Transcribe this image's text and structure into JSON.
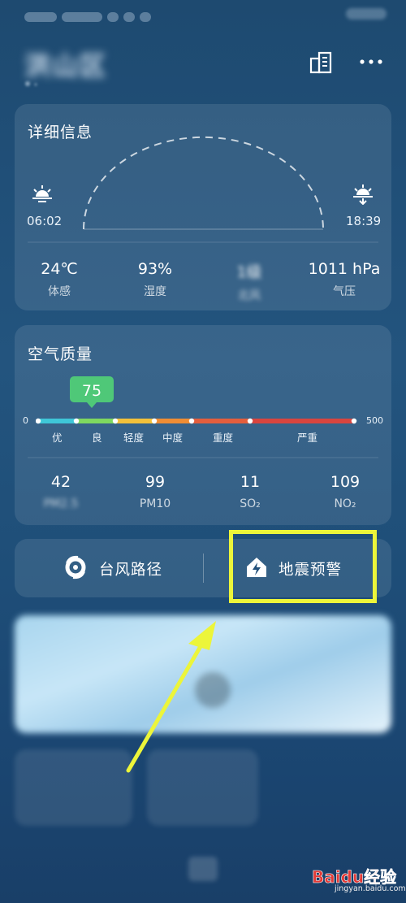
{
  "status_bar": {
    "left": "",
    "right": ""
  },
  "header": {
    "location": "洪山区"
  },
  "details": {
    "title": "详细信息",
    "sunrise": "06:02",
    "sunset": "18:39",
    "stats": [
      {
        "value": "24℃",
        "label": "体感"
      },
      {
        "value": "93%",
        "label": "湿度"
      },
      {
        "value": "1级",
        "label": "北风"
      },
      {
        "value": "1011 hPa",
        "label": "气压"
      }
    ]
  },
  "air_quality": {
    "title": "空气质量",
    "aqi": "75",
    "scale_min": "0",
    "scale_max": "500",
    "levels": [
      "优",
      "良",
      "轻度",
      "中度",
      "重度",
      "严重"
    ],
    "level_colors": [
      "#3fc7d8",
      "#7fd85f",
      "#f3c13a",
      "#f08d34",
      "#e45e3d",
      "#d9453f"
    ],
    "pollutants": [
      {
        "value": "42",
        "label": "PM2.5"
      },
      {
        "value": "99",
        "label": "PM10"
      },
      {
        "value": "11",
        "label": "SO₂"
      },
      {
        "value": "109",
        "label": "NO₂"
      }
    ]
  },
  "features": {
    "typhoon_label": "台风路径",
    "earthquake_label": "地震预警"
  },
  "video": {
    "title": ""
  },
  "mini_cards": [
    {
      "title": "",
      "subtitle": ""
    },
    {
      "title": "",
      "subtitle": ""
    }
  ],
  "footer": {
    "left": "",
    "right": ""
  },
  "watermark": {
    "brand": "Baidu经验",
    "site": "jingyan.baidu.com"
  },
  "colors": {
    "highlight": "#ecf53a",
    "aqi_badge": "#4fc878"
  }
}
